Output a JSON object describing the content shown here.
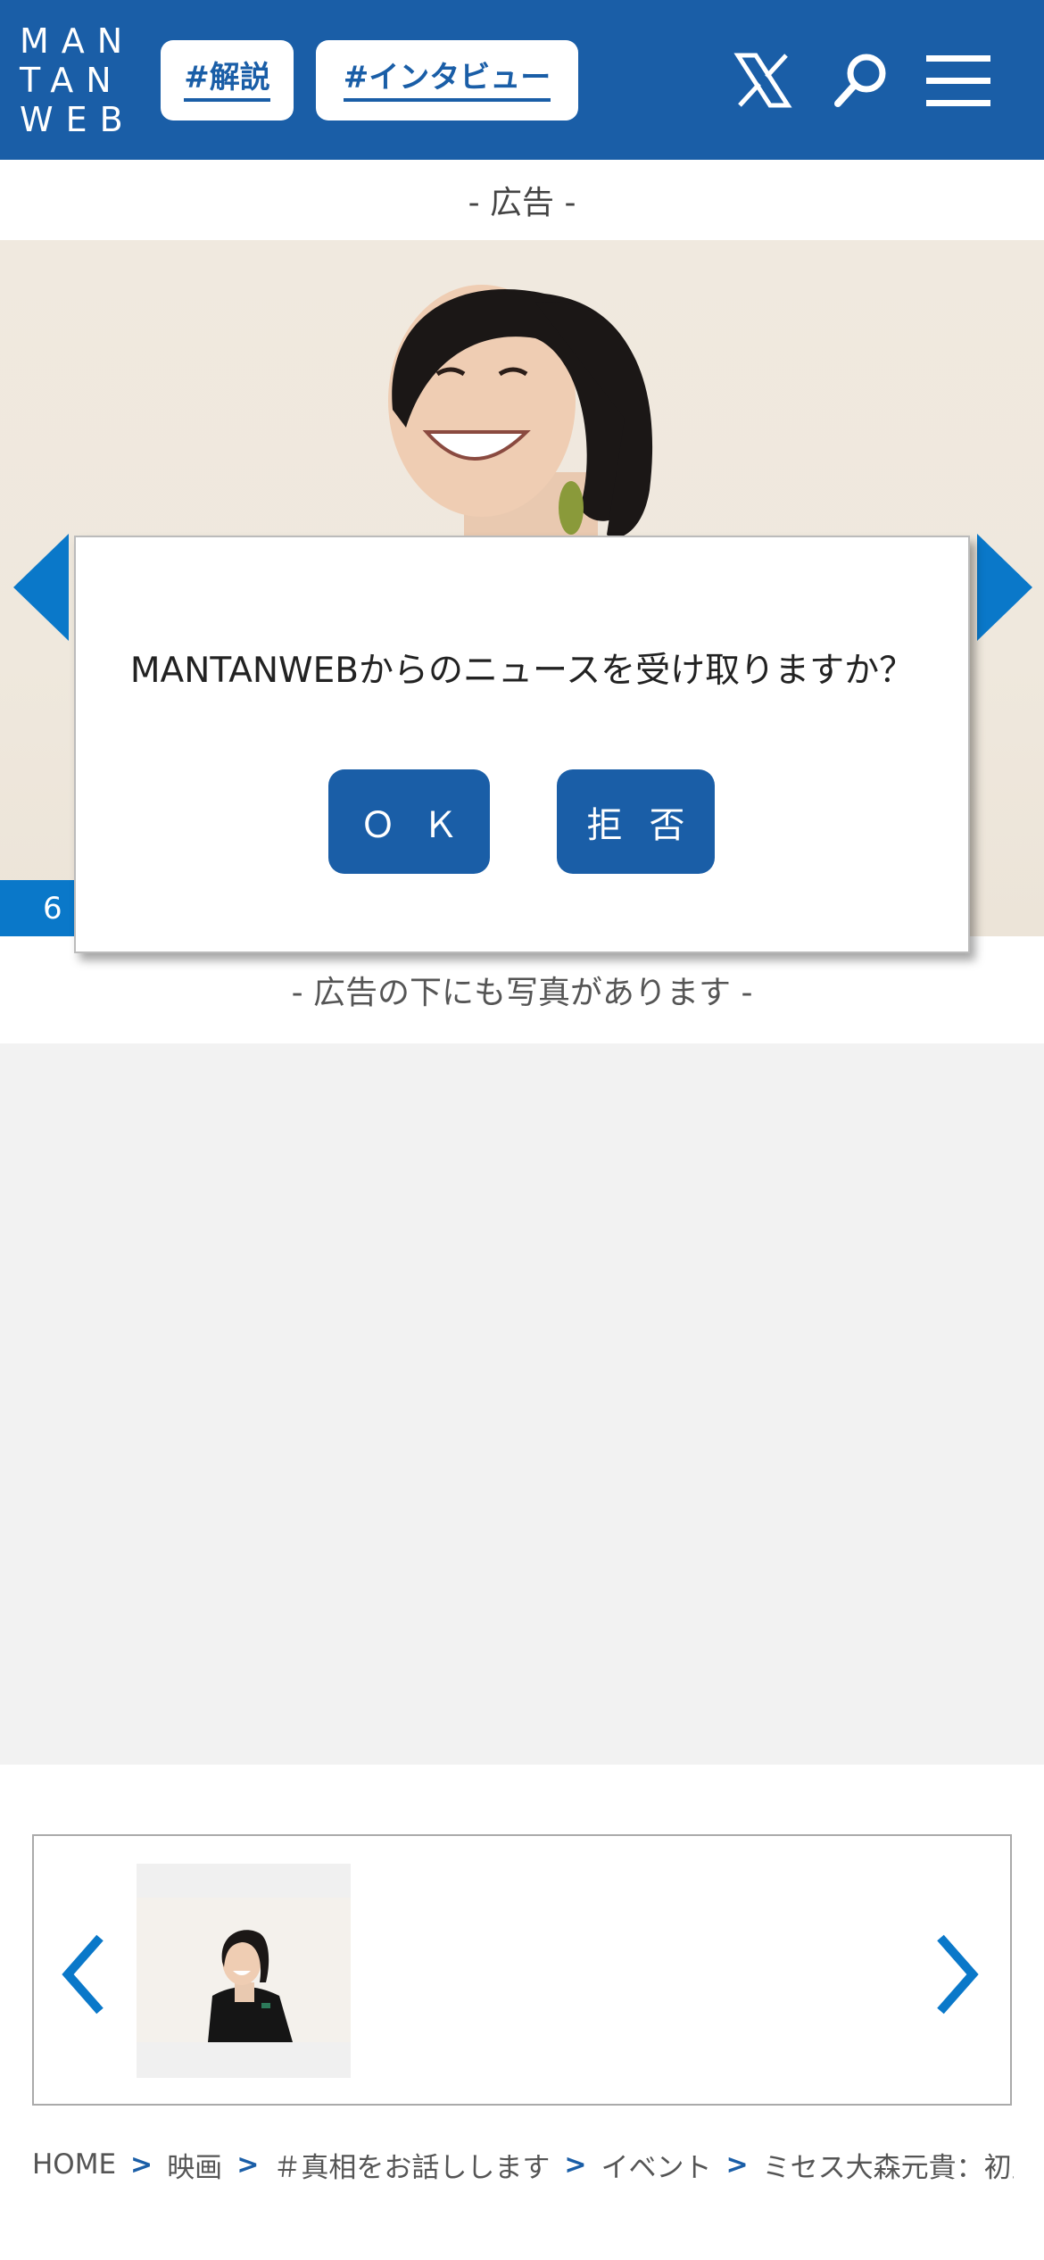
{
  "header": {
    "logo_lines": [
      "MAN",
      "TAN",
      "WEB"
    ],
    "tags": [
      "#解説",
      "#インタビュー"
    ],
    "icons": [
      "x-icon",
      "search-icon",
      "menu-icon"
    ],
    "bg_color": "#1a5ea7"
  },
  "ad_label": "- 広告 -",
  "photo": {
    "counter": "6"
  },
  "below_label": "- 広告の下にも写真があります -",
  "dialog": {
    "message": "MANTANWEBからのニュースを受け取りますか？",
    "ok_label": "ＯＫ",
    "deny_label": "拒否"
  },
  "breadcrumb": {
    "items": [
      "HOME",
      "映画",
      "＃真相をお話しします",
      "イベント",
      "ミセス大森元貴：初主演"
    ],
    "separator": ">"
  }
}
